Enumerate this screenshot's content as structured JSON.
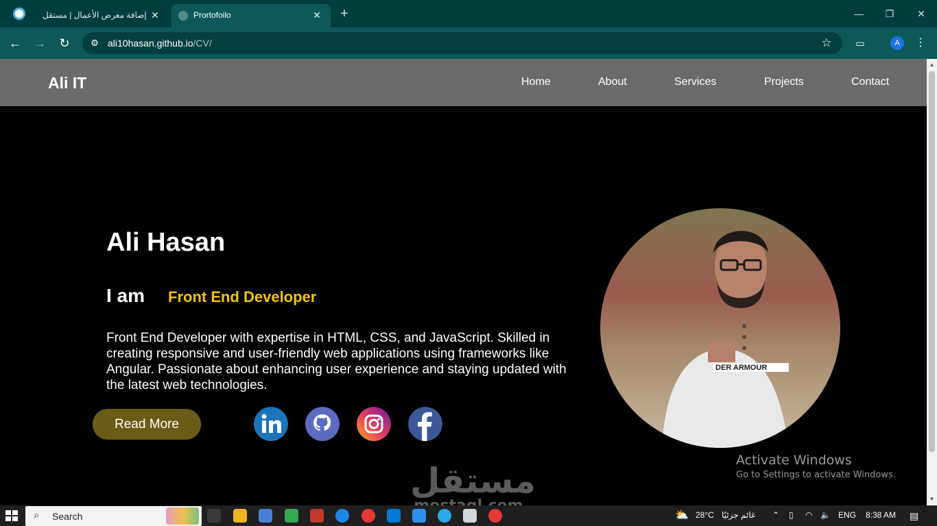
{
  "browser": {
    "tabs": [
      {
        "title": "إضافة معرض الأعمال | مستقل",
        "active": false
      },
      {
        "title": "Prortofoilo",
        "active": true
      }
    ],
    "url_host": "ali10hasan.github.io",
    "url_path": "/CV/",
    "profile_initial": "A"
  },
  "site": {
    "logo": "Ali IT",
    "nav": [
      "Home",
      "About",
      "Services",
      "Projects",
      "Contact"
    ],
    "hero": {
      "name": "Ali Hasan",
      "iam": "I am",
      "role": "Front End Developer",
      "bio": "Front End Developer with expertise in HTML, CSS, and JavaScript. Skilled in creating responsive and user-friendly web applications using frameworks like Angular. Passionate about enhancing user experience and staying updated with the latest web technologies.",
      "cta": "Read More",
      "socials": [
        "linkedin-icon",
        "github-icon",
        "instagram-icon",
        "facebook-icon"
      ]
    },
    "colors": {
      "navbar": "#6b6b6b",
      "accent": "#f5c400",
      "button": "#6a5c16"
    }
  },
  "overlay": {
    "activate_title": "Activate Windows",
    "activate_sub": "Go to Settings to activate Windows.",
    "watermark_ar": "مستقل",
    "watermark_lat": "mostaql.com"
  },
  "taskbar": {
    "search_label": "Search",
    "weather_temp": "28°C",
    "weather_text": "غائم جزئيًا",
    "lang": "ENG",
    "time": "8:38 AM"
  }
}
